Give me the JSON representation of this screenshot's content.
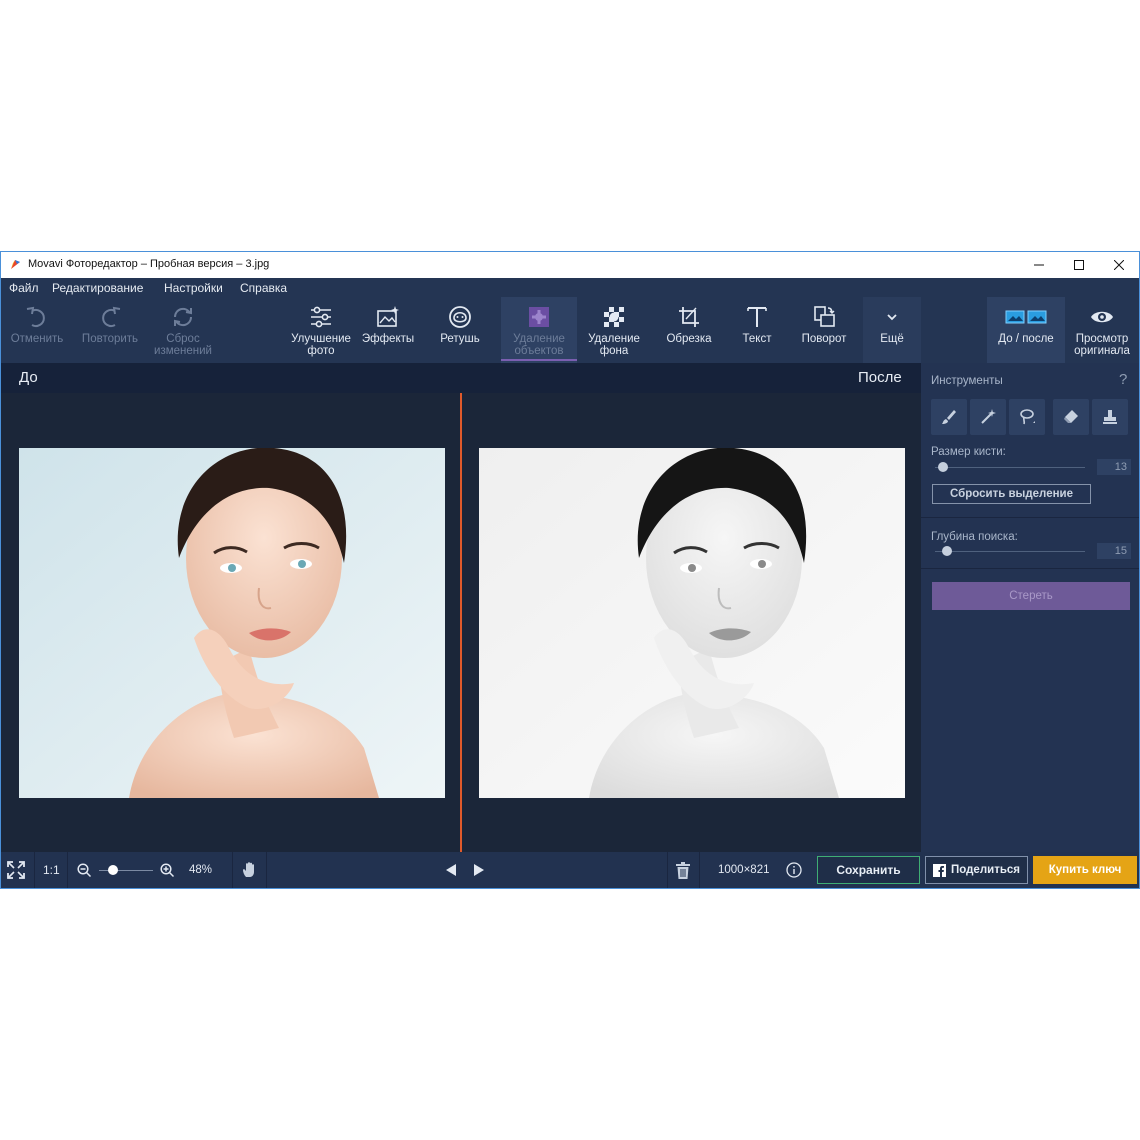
{
  "window": {
    "title": "Movavi Фоторедактор – Пробная версия – 3.jpg"
  },
  "menu": {
    "file": "Файл",
    "edit": "Редактирование",
    "settings": "Настройки",
    "help": "Справка"
  },
  "toolbar": {
    "undo": "Отменить",
    "redo": "Повторить",
    "reset": "Сброс\nизменений",
    "enhance": "Улучшение\nфото",
    "effects": "Эффекты",
    "retouch": "Ретушь",
    "object_removal": "Удаление\nобъектов",
    "background_removal": "Удаление\nфона",
    "crop": "Обрезка",
    "text": "Текст",
    "rotate": "Поворот",
    "more": "Ещё",
    "before_after": "До / после",
    "view_original": "Просмотр\nоригинала"
  },
  "canvas": {
    "before_label": "До",
    "after_label": "После"
  },
  "panel": {
    "tools_title": "Инструменты",
    "help": "?",
    "brush_size_label": "Размер кисти:",
    "brush_size_value": "13",
    "brush_size_fraction": 0.05,
    "reset_selection": "Сбросить выделение",
    "search_depth_label": "Глубина поиска:",
    "search_depth_value": "15",
    "search_depth_fraction": 0.08,
    "erase": "Стереть"
  },
  "status": {
    "fit": "⛶",
    "actual_size": "1:1",
    "zoom": "48%",
    "zoom_fraction": 0.25,
    "dimensions": "1000×821",
    "save": "Сохранить",
    "share": "Поделиться",
    "buy": "Купить ключ"
  },
  "colors": {
    "accent_active": "#7b5fb0",
    "divider": "#e05a2b",
    "save_border": "#3fae74",
    "buy_bg": "#e5a415"
  }
}
